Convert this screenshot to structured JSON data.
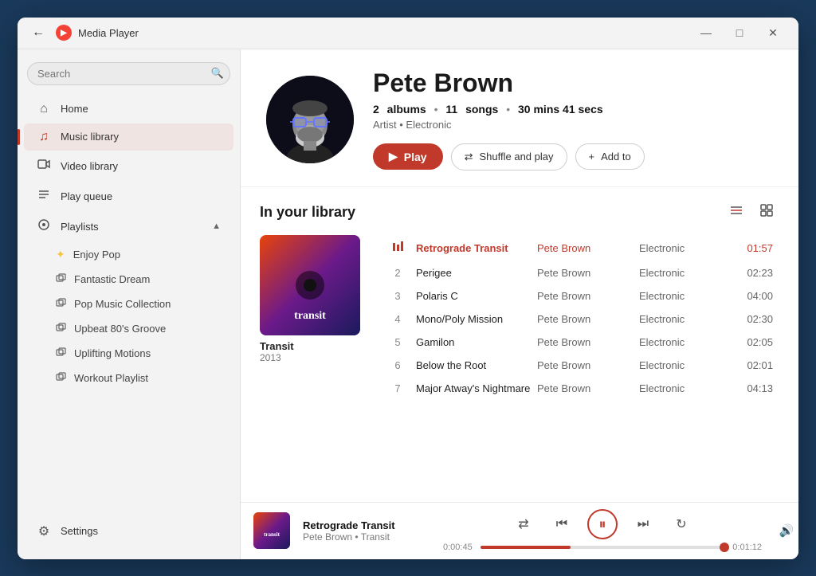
{
  "window": {
    "title": "Media Player",
    "logo": "▶"
  },
  "titlebar": {
    "back_label": "←",
    "minimize_label": "—",
    "maximize_label": "□",
    "close_label": "✕"
  },
  "sidebar": {
    "search_placeholder": "Search",
    "nav": [
      {
        "id": "home",
        "icon": "⌂",
        "label": "Home"
      },
      {
        "id": "music-library",
        "icon": "♪",
        "label": "Music library",
        "active": true
      },
      {
        "id": "video-library",
        "icon": "□",
        "label": "Video library"
      },
      {
        "id": "play-queue",
        "icon": "≡",
        "label": "Play queue"
      }
    ],
    "playlists_label": "Playlists",
    "playlists": [
      {
        "id": "enjoy-pop",
        "label": "Enjoy Pop",
        "icon": "✦"
      },
      {
        "id": "fantastic-dream",
        "label": "Fantastic Dream",
        "icon": "♪"
      },
      {
        "id": "pop-music-collection",
        "label": "Pop Music Collection",
        "icon": "♪"
      },
      {
        "id": "upbeat-80s-groove",
        "label": "Upbeat 80's Groove",
        "icon": "♪"
      },
      {
        "id": "uplifting-motions",
        "label": "Uplifting Motions",
        "icon": "♪"
      },
      {
        "id": "workout-playlist",
        "label": "Workout Playlist",
        "icon": "♪"
      }
    ],
    "settings_label": "Settings",
    "settings_icon": "⚙"
  },
  "artist": {
    "name": "Pete Brown",
    "albums_count": "2",
    "songs_count": "11",
    "duration": "30 mins 41 secs",
    "type": "Artist",
    "genre": "Electronic",
    "meta_dot": "•",
    "btn_play": "Play",
    "btn_shuffle": "Shuffle and play",
    "btn_add": "Add to"
  },
  "library": {
    "title": "In your library",
    "albums": [
      {
        "id": "transit",
        "name": "Transit",
        "year": "2013",
        "label": "transit"
      }
    ],
    "songs": [
      {
        "num": "1",
        "name": "Retrograde Transit",
        "artist": "Pete Brown",
        "genre": "Electronic",
        "duration": "01:57",
        "active": true
      },
      {
        "num": "2",
        "name": "Perigee",
        "artist": "Pete Brown",
        "genre": "Electronic",
        "duration": "02:23",
        "active": false
      },
      {
        "num": "3",
        "name": "Polaris C",
        "artist": "Pete Brown",
        "genre": "Electronic",
        "duration": "04:00",
        "active": false
      },
      {
        "num": "4",
        "name": "Mono/Poly Mission",
        "artist": "Pete Brown",
        "genre": "Electronic",
        "duration": "02:30",
        "active": false
      },
      {
        "num": "5",
        "name": "Gamilon",
        "artist": "Pete Brown",
        "genre": "Electronic",
        "duration": "02:05",
        "active": false
      },
      {
        "num": "6",
        "name": "Below the Root",
        "artist": "Pete Brown",
        "genre": "Electronic",
        "duration": "02:01",
        "active": false
      },
      {
        "num": "7",
        "name": "Major Atway's Nightmare",
        "artist": "Pete Brown",
        "genre": "Electronic",
        "duration": "04:13",
        "active": false
      }
    ]
  },
  "nowplaying": {
    "title": "Retrograde Transit",
    "artist": "Pete Brown",
    "album": "Transit",
    "time_current": "0:00:45",
    "time_total": "0:01:12",
    "progress_pct": 37
  },
  "colors": {
    "accent": "#c0392b",
    "active_nav": "rgba(192,57,43,0.08)"
  }
}
